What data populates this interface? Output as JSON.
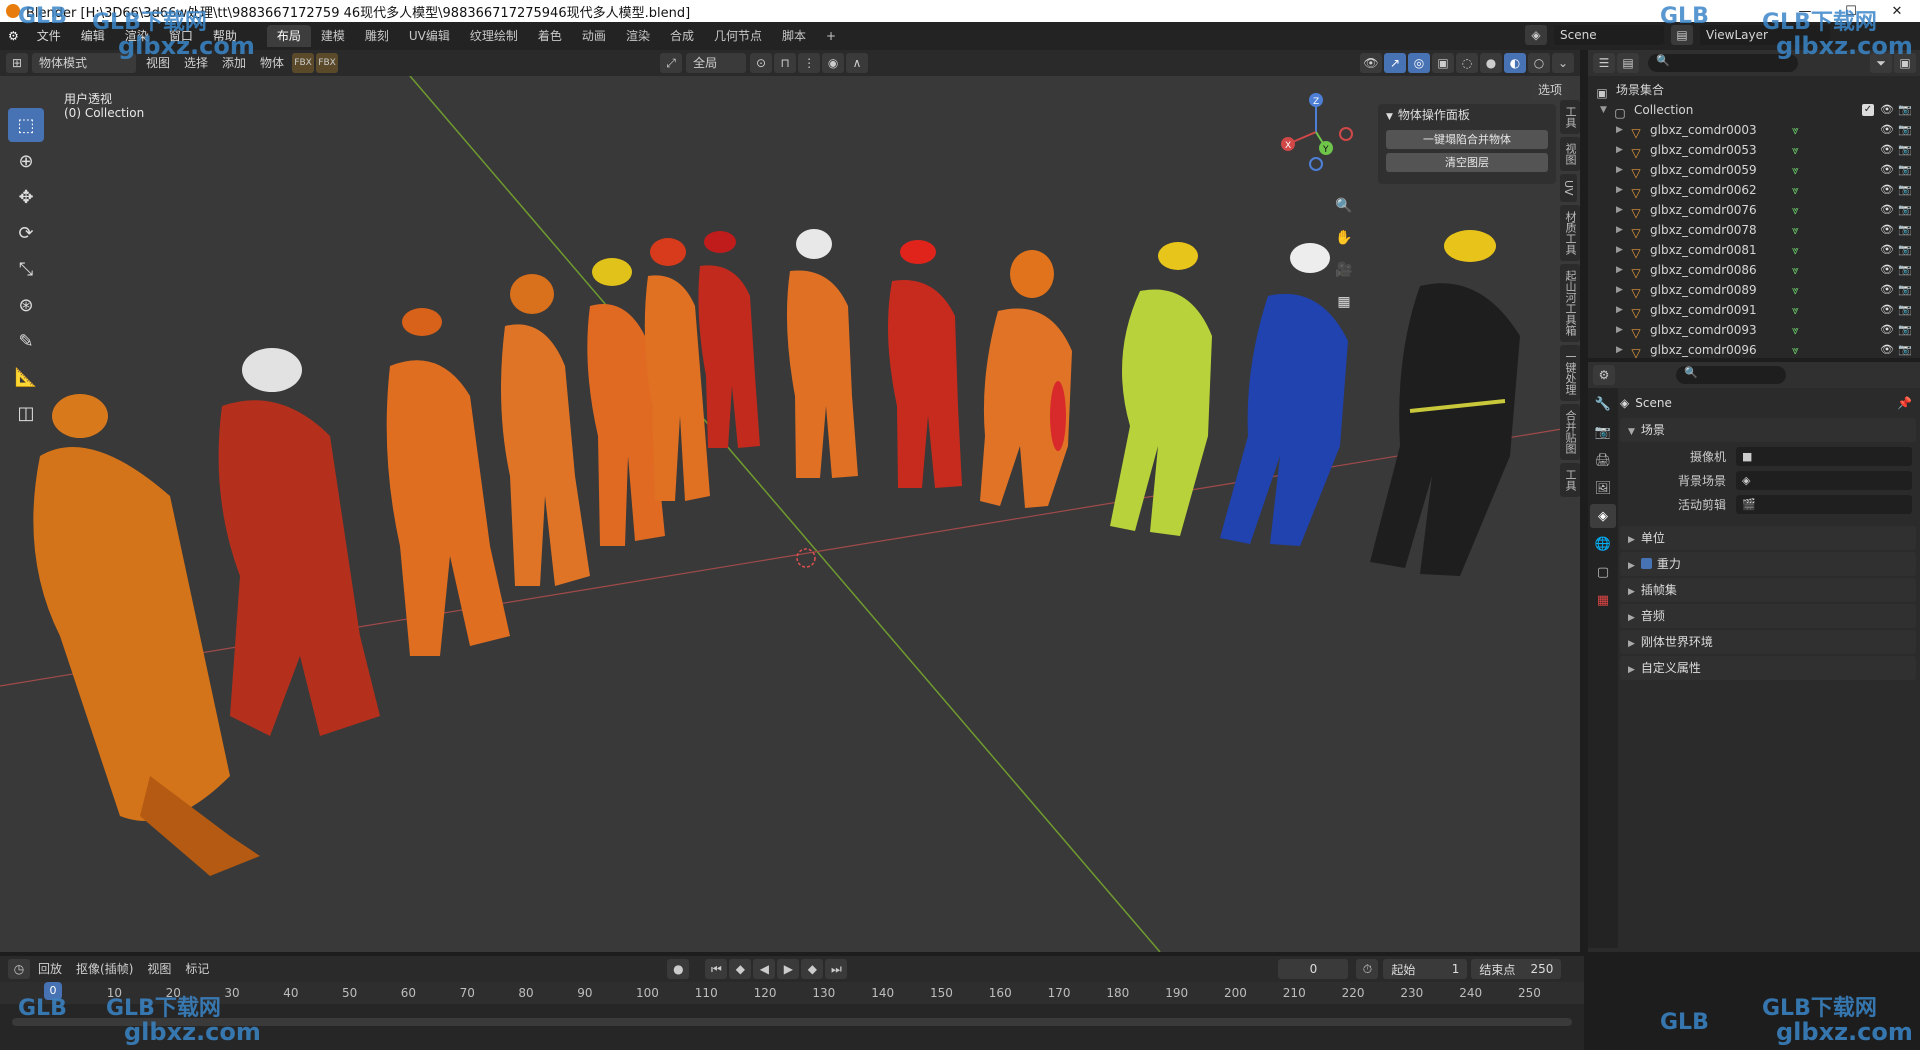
{
  "titlebar": {
    "title": "Blender [H:\\3D66\\3d66w处理\\tt\\9883667172759 46现代多人模型\\988366717275946现代多人模型.blend]"
  },
  "menu": {
    "items": [
      "文件",
      "编辑",
      "渲染",
      "窗口",
      "帮助"
    ]
  },
  "workspaces": {
    "tabs": [
      "布局",
      "建模",
      "雕刻",
      "UV编辑",
      "纹理绘制",
      "着色",
      "动画",
      "渲染",
      "合成",
      "几何节点",
      "脚本"
    ],
    "add": "+"
  },
  "topright": {
    "scene": "Scene",
    "view_layer": "ViewLayer"
  },
  "viewport_header": {
    "mode": "物体模式",
    "menus": [
      "视图",
      "选择",
      "添加",
      "物体"
    ],
    "transform_orientation": "全局",
    "options": "选项"
  },
  "viewport": {
    "view_name": "用户透视",
    "collection_label": "(0) Collection"
  },
  "gizmo": {
    "x": "X",
    "y": "Y",
    "z": "Z"
  },
  "ops_panel": {
    "title": "物体操作面板",
    "btn1": "一键塌陷合并物体",
    "btn2": "清空图层"
  },
  "npanel_tabs": [
    "工具",
    "视图",
    "UV",
    "材质工具",
    "起山河工具箱",
    "一键处理",
    "合并贴图",
    "工具"
  ],
  "outliner": {
    "root": "场景集合",
    "collection": "Collection",
    "objects": [
      "glbxz_comdr0003",
      "glbxz_comdr0053",
      "glbxz_comdr0059",
      "glbxz_comdr0062",
      "glbxz_comdr0076",
      "glbxz_comdr0078",
      "glbxz_comdr0081",
      "glbxz_comdr0086",
      "glbxz_comdr0089",
      "glbxz_comdr0091",
      "glbxz_comdr0093",
      "glbxz_comdr0096"
    ]
  },
  "properties": {
    "context": "Scene",
    "section_scene": "场景",
    "camera_label": "摄像机",
    "background_label": "背景场景",
    "active_clip_label": "活动剪辑",
    "sections": [
      "单位",
      "重力",
      "插帧集",
      "音频",
      "刚体世界环境",
      "自定义属性"
    ]
  },
  "timeline": {
    "menus": [
      "回放",
      "抠像(插帧)",
      "视图",
      "标记"
    ],
    "current_frame": "0",
    "start_label": "起始",
    "start_value": "1",
    "end_label": "结束点",
    "end_value": "250",
    "ruler": [
      "0",
      "10",
      "20",
      "30",
      "40",
      "50",
      "60",
      "70",
      "80",
      "90",
      "100",
      "110",
      "120",
      "130",
      "140",
      "150",
      "160",
      "170",
      "180",
      "190",
      "200",
      "210",
      "220",
      "230",
      "240",
      "250"
    ]
  },
  "watermarks": {
    "glb": "GLB下载网",
    "url": "glbxz.com"
  }
}
